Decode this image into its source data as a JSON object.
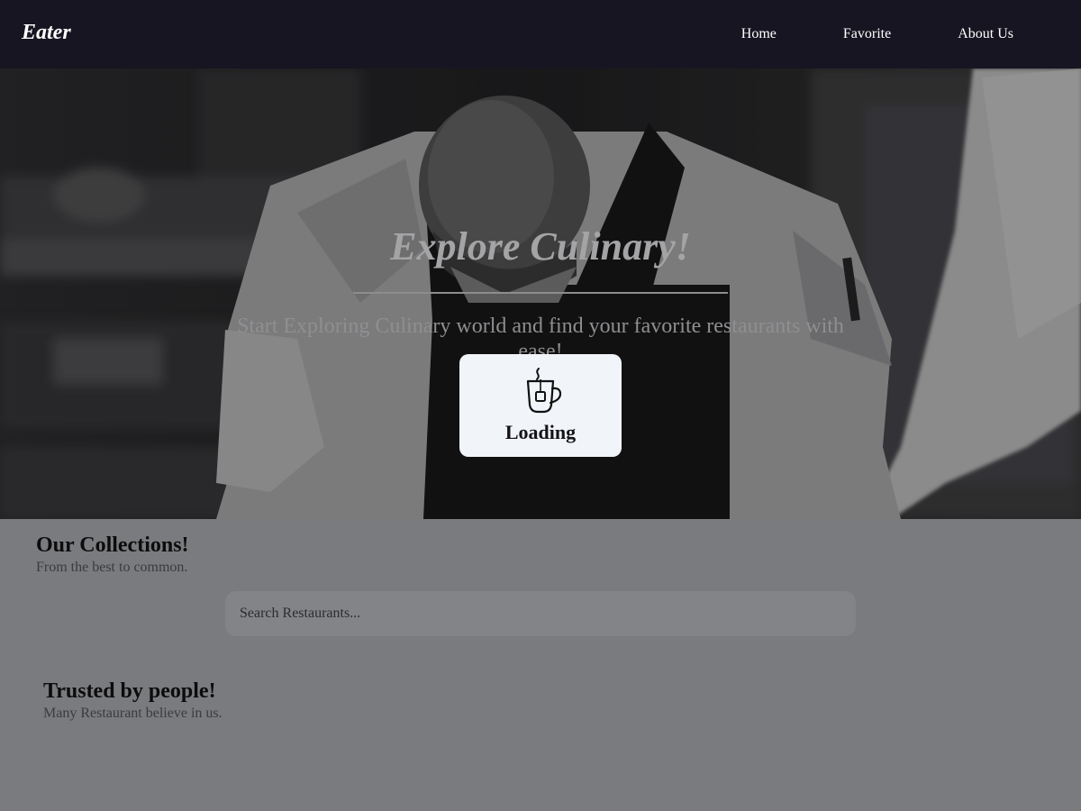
{
  "navbar": {
    "brand": "Eater",
    "links": [
      "Home",
      "Favorite",
      "About Us"
    ]
  },
  "hero": {
    "title": "Explore Culinary!",
    "subtitle": "Start Exploring Culinary world and find your favorite restaurants with ease!"
  },
  "collections": {
    "title": "Our Collections!",
    "subtitle": "From the best to common.",
    "search_placeholder": "Search Restaurants..."
  },
  "trusted": {
    "title": "Trusted by people!",
    "subtitle": "Many Restaurant believe in us."
  },
  "loading": {
    "label": "Loading",
    "icon": "tea-cup-icon"
  },
  "colors": {
    "navbar_bg": "#171522",
    "page_overlay": "#7a7b7e",
    "loading_card_bg": "#f1f4f8"
  }
}
